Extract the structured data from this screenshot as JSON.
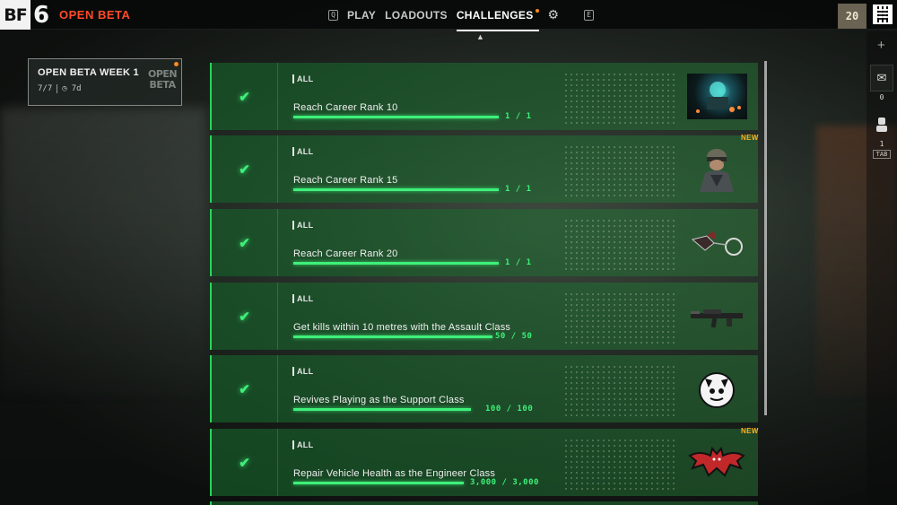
{
  "header": {
    "logo_bf": "BF",
    "logo_num": "6",
    "mode_title": "OPEN BETA",
    "nav": [
      {
        "key": "Q",
        "label": ""
      },
      {
        "label": "PLAY"
      },
      {
        "label": "LOADOUTS"
      },
      {
        "label": "CHALLENGES",
        "active": true,
        "notify": true
      },
      {
        "key": "E",
        "label": ""
      }
    ],
    "player_rank": "20"
  },
  "rail": {
    "mail_count": "0",
    "squad_count": "1",
    "tab_key": "TAB"
  },
  "week_card": {
    "title": "OPEN BETA WEEK 1",
    "progress": "7/7",
    "time_left": "7d",
    "badge_line1": "OPEN",
    "badge_line2": "BETA"
  },
  "challenges": [
    {
      "category": "ALL",
      "name": "Reach Career Rank 10",
      "progress": "1 / 1",
      "fraction": 1.0,
      "is_new": false,
      "thumb": "cinematic-scene"
    },
    {
      "category": "ALL",
      "name": "Reach Career Rank 15",
      "progress": "1 / 1",
      "fraction": 1.0,
      "is_new": true,
      "new_label": "NEW",
      "thumb": "soldier-portrait"
    },
    {
      "category": "ALL",
      "name": "Reach Career Rank 20",
      "progress": "1 / 1",
      "fraction": 1.0,
      "is_new": false,
      "thumb": "weapon-charm"
    },
    {
      "category": "ALL",
      "name": "Get kills within 10 metres with the Assault Class",
      "progress": "50 / 50",
      "fraction": 1.0,
      "is_new": false,
      "thumb": "assault-rifle"
    },
    {
      "category": "ALL",
      "name": "Revives Playing as the Support Class",
      "progress": "100 / 100",
      "fraction": 1.0,
      "is_new": false,
      "thumb": "cat-patch"
    },
    {
      "category": "ALL",
      "name": "Repair Vehicle Health as the Engineer Class",
      "progress": "3,000 / 3,000",
      "fraction": 1.0,
      "is_new": true,
      "new_label": "NEW",
      "thumb": "bat-patch"
    }
  ],
  "colors": {
    "accent_green": "#3ef07a",
    "beta_red": "#ff4a2a",
    "new_orange": "#ffb020"
  }
}
